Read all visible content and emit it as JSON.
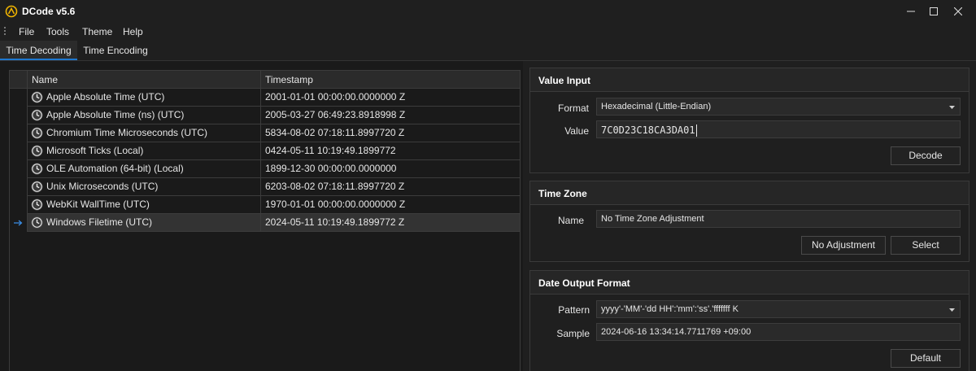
{
  "window": {
    "title": "DCode v5.6",
    "icon": "dcode-logo-icon"
  },
  "window_controls": [
    "minimize-icon",
    "maximize-icon",
    "close-icon"
  ],
  "menu": {
    "items": [
      "File",
      "Tools",
      "Theme",
      "Help"
    ]
  },
  "tabs": [
    {
      "label": "Time Decoding",
      "active": true
    },
    {
      "label": "Time Encoding",
      "active": false
    }
  ],
  "results": {
    "columns": [
      "Name",
      "Timestamp"
    ],
    "rows": [
      {
        "name": "Apple Absolute Time (UTC)",
        "timestamp": "2001-01-01 00:00:00.0000000 Z"
      },
      {
        "name": "Apple Absolute Time (ns) (UTC)",
        "timestamp": "2005-03-27 06:49:23.8918998 Z"
      },
      {
        "name": "Chromium Time Microseconds (UTC)",
        "timestamp": "5834-08-02 07:18:11.8997720 Z"
      },
      {
        "name": "Microsoft Ticks (Local)",
        "timestamp": "0424-05-11 10:19:49.1899772"
      },
      {
        "name": "OLE Automation (64-bit) (Local)",
        "timestamp": "1899-12-30 00:00:00.0000000"
      },
      {
        "name": "Unix Microseconds (UTC)",
        "timestamp": "6203-08-02 07:18:11.8997720 Z"
      },
      {
        "name": "WebKit WallTime (UTC)",
        "timestamp": "1970-01-01 00:00:00.0000000 Z"
      },
      {
        "name": "Windows Filetime (UTC)",
        "timestamp": "2024-05-11 10:19:49.1899772 Z"
      }
    ],
    "selected_index": 7,
    "row_icon": "clock-icon",
    "selected_marker": "row-arrow-icon"
  },
  "value_input": {
    "title": "Value Input",
    "format_label": "Format",
    "format_value": "Hexadecimal (Little-Endian)",
    "value_label": "Value",
    "value": "7C0D23C18CA3DA01",
    "decode_button": "Decode"
  },
  "time_zone": {
    "title": "Time Zone",
    "name_label": "Name",
    "name_value": "No Time Zone Adjustment",
    "no_adjust_button": "No Adjustment",
    "select_button": "Select"
  },
  "date_output": {
    "title": "Date Output Format",
    "pattern_label": "Pattern",
    "pattern_value": "yyyy'-'MM'-'dd HH':'mm':'ss'.'fffffff K",
    "sample_label": "Sample",
    "sample_value": "2024-06-16 13:34:14.7711769 +09:00",
    "default_button": "Default"
  },
  "colors": {
    "background": "#1f1f1f",
    "grid_background": "#1a1a1a",
    "header_background": "#2b2b2b",
    "selected_row": "#333333",
    "accent": "#1e78d0",
    "logo": "#f0b400"
  }
}
